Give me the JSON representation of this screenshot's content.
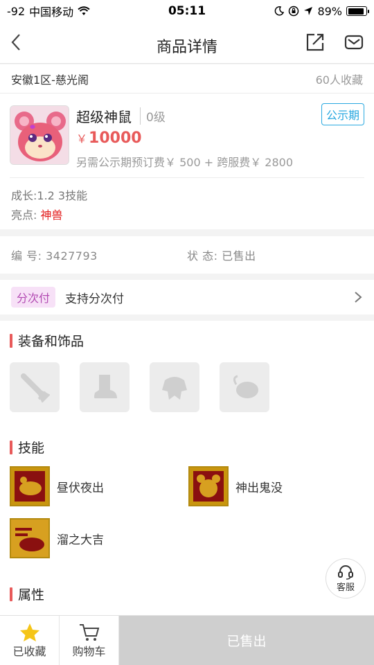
{
  "status_bar": {
    "signal": "-92",
    "carrier": "中国移动",
    "time": "05:11",
    "battery_percent": "89%",
    "battery_level": 0.89
  },
  "nav": {
    "title": "商品详情"
  },
  "server": {
    "name": "安徽1区-慈光阁",
    "favorites": "60人收藏"
  },
  "goods": {
    "name": "超级神鼠",
    "level": "0级",
    "public_tag": "公示期",
    "price_symbol": "￥",
    "price": "10000",
    "extra_fee": "另需公示期预订费￥ 500 + 跨服费￥ 2800",
    "growth": "成长:1.2 3技能",
    "highlight_label": "亮点: ",
    "highlight_value": "神兽"
  },
  "meta": {
    "id_label": "编 号: ",
    "id_value": "3427793",
    "state_label": "状 态: ",
    "state_value": "已售出"
  },
  "installment": {
    "tag": "分次付",
    "text": "支持分次付"
  },
  "sections": {
    "equipment": "装备和饰品",
    "skills": "技能",
    "attributes": "属性"
  },
  "equipment_slots": [
    {
      "icon": "sword-icon"
    },
    {
      "icon": "boot-icon"
    },
    {
      "icon": "armor-icon"
    },
    {
      "icon": "ornament-icon"
    }
  ],
  "skills": [
    {
      "name": "昼伏夜出"
    },
    {
      "name": "神出鬼没"
    },
    {
      "name": "溜之大吉"
    }
  ],
  "service": {
    "label": "客服"
  },
  "bottom_bar": {
    "favorited": "已收藏",
    "cart": "购物车",
    "sold": "已售出"
  },
  "colors": {
    "accent_red": "#e85a5a",
    "highlight_red": "#e31b1b",
    "public_blue": "#28a8e0",
    "star_yellow": "#f5c518"
  }
}
